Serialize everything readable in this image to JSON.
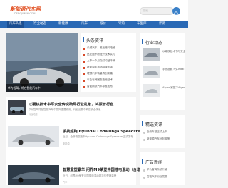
{
  "site": {
    "logo_text": "新能源汽车网",
    "logo_sub": "DENGJIMEN.COM",
    "search_placeholder": "搜索"
  },
  "nav": {
    "items": [
      "汽车头条",
      "行业动态",
      "新能源",
      "汽车",
      "报价",
      "导购",
      "车型库",
      "评测"
    ],
    "active_index": 0
  },
  "banner": {
    "caption": "华为智驾，将在智能汽车中"
  },
  "headlines": {
    "title": "头条资讯",
    "items": [
      "长城汽车，推出燃料电池",
      "比亚迪不断提升技术实力",
      "上市一个月交付均破千辆",
      "新能源车市场持续走强",
      "理想汽车销量再创新高",
      "车企布局固态电池技术",
      "智能网联汽车标准发布"
    ]
  },
  "articles": [
    {
      "title": "以硬核技术书写安全传说破局行业乱象，鸿蒙智行直",
      "desc": "华为智驾将在智能汽车中发挥重要作用，行业乱象中构建安全体系",
      "tag": "行业动态"
    },
    {
      "title": "手找超跑 Hyundai Codalunga Speedster发布",
      "desc": "近日，全新概念跑车Hyundai Codalunga Speedster正式发布",
      "tag": "新能源"
    },
    {
      "title": "智慧重塑豪华 问界M9荣登中国插电混动（含增程）",
      "desc": "近日，问界M9荣登中国插电混动豪华车型销量榜",
      "tag": "汽车"
    }
  ],
  "sidebar": {
    "news_title": "行业动态",
    "news_items": [
      "以硬核技术书写安全传说破局行业",
      "手找超跑 Hyundai Codalunga Speedster发布",
      "Alpine家族下Aigena A390亮相"
    ],
    "select_title": "精选资讯",
    "select_items": [
      "全新车型正式上市",
      "新能源汽车补贴政策"
    ],
    "ad_title": "广告新闻",
    "ad_items": [
      "华为智驾系统升级",
      "智能汽车行业发展"
    ]
  },
  "colors": {
    "nav_bg": "#2a69b5",
    "logo": "#e04a1a",
    "accent": "#d84a2a"
  }
}
